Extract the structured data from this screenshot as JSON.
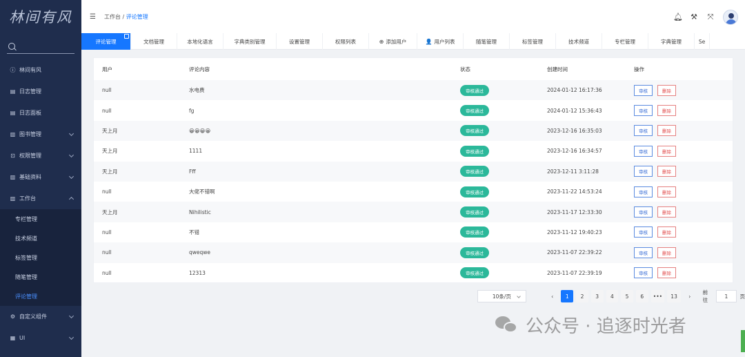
{
  "sidebar": {
    "logo": "林间有风",
    "items": [
      {
        "icon": "info-icon",
        "label": "林间有风",
        "arrow": ""
      },
      {
        "icon": "doc-icon",
        "label": "日志管理",
        "arrow": ""
      },
      {
        "icon": "doc-icon",
        "label": "日志面板",
        "arrow": ""
      },
      {
        "icon": "book-icon",
        "label": "图书管理",
        "arrow": "down"
      },
      {
        "icon": "lock-icon",
        "label": "权限管理",
        "arrow": "down"
      },
      {
        "icon": "book-icon",
        "label": "基础资料",
        "arrow": "down"
      },
      {
        "icon": "book-icon",
        "label": "工作台",
        "arrow": "up"
      }
    ],
    "sub_items": [
      "专栏管理",
      "技术频道",
      "标签管理",
      "随笔管理",
      "评论管理"
    ],
    "bottom_items": [
      {
        "icon": "gear-icon",
        "label": "自定义组件",
        "arrow": "down"
      },
      {
        "icon": "grid-icon",
        "label": "UI",
        "arrow": "down"
      }
    ]
  },
  "header": {
    "breadcrumb_parent": "工作台",
    "breadcrumb_sep": "/",
    "breadcrumb_current": "评论管理",
    "icons": [
      "bell-icon",
      "tools-icon",
      "fullscreen-icon"
    ]
  },
  "tabs": [
    {
      "label": "评论管理",
      "width": 72,
      "active": true,
      "icon": ""
    },
    {
      "label": "文档管理",
      "width": 67,
      "icon": ""
    },
    {
      "label": "本地化语言",
      "width": 67,
      "icon": ""
    },
    {
      "label": "字典类别管理",
      "width": 77,
      "icon": ""
    },
    {
      "label": "设置管理",
      "width": 67,
      "icon": ""
    },
    {
      "label": "权限列表",
      "width": 67,
      "icon": ""
    },
    {
      "label": "添加用户",
      "width": 70,
      "icon": "⊕"
    },
    {
      "label": "用户列表",
      "width": 67,
      "icon": "👤"
    },
    {
      "label": "随笔管理",
      "width": 67,
      "icon": ""
    },
    {
      "label": "标签管理",
      "width": 67,
      "icon": ""
    },
    {
      "label": "技术频道",
      "width": 67,
      "icon": ""
    },
    {
      "label": "专栏管理",
      "width": 67,
      "icon": ""
    },
    {
      "label": "字典管理",
      "width": 67,
      "icon": ""
    },
    {
      "label": "Se",
      "width": 22,
      "icon": ""
    }
  ],
  "table": {
    "columns": [
      "用户",
      "评论内容",
      "状态",
      "创建时间",
      "操作"
    ],
    "status_label": "审核通过",
    "audit_label": "审核",
    "delete_label": "删除",
    "rows": [
      {
        "user": "null",
        "content": "水电费",
        "time": "2024-01-12 16:17:36"
      },
      {
        "user": "null",
        "content": "fg",
        "time": "2024-01-12 15:36:43"
      },
      {
        "user": "天上月",
        "content": "😀😀😀😀",
        "time": "2023-12-16 16:35:03"
      },
      {
        "user": "天上月",
        "content": "1111",
        "time": "2023-12-16 16:34:57"
      },
      {
        "user": "天上月",
        "content": "Fff",
        "time": "2023-12-11 3:11:28"
      },
      {
        "user": "null",
        "content": "大佬不错啊",
        "time": "2023-11-22 14:53:24"
      },
      {
        "user": "天上月",
        "content": "Nihilistic",
        "time": "2023-11-17 12:33:30"
      },
      {
        "user": "null",
        "content": "不错",
        "time": "2023-11-12 19:40:23"
      },
      {
        "user": "null",
        "content": "qweqwe",
        "time": "2023-11-07 22:39:22"
      },
      {
        "user": "null",
        "content": "12313",
        "time": "2023-11-07 22:39:19"
      }
    ]
  },
  "pagination": {
    "page_size": "10条/页",
    "prev": "‹",
    "pages": [
      "1",
      "2",
      "3",
      "4",
      "5",
      "6",
      "•••",
      "13"
    ],
    "current": "1",
    "next": "›",
    "goto_label": "前往",
    "goto_value": "1",
    "goto_suffix": "页"
  },
  "watermark": "公众号 · 追逐时光者",
  "colors": {
    "primary": "#1677ff",
    "sidebar": "#1f2d4d",
    "status": "#2bb89a",
    "danger": "#e24b4b"
  }
}
